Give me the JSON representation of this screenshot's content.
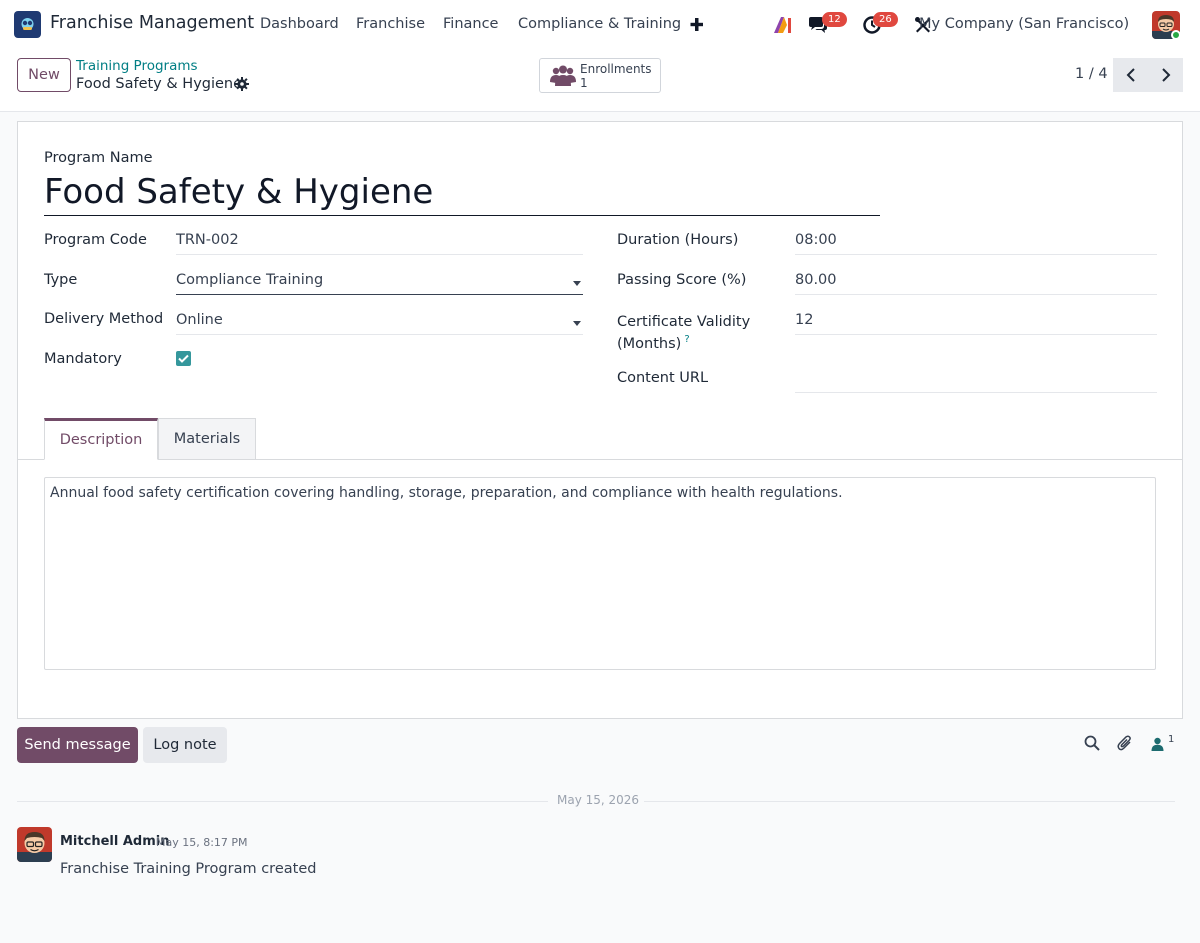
{
  "navbar": {
    "app_title": "Franchise Management",
    "menus": [
      "Dashboard",
      "Franchise",
      "Finance",
      "Compliance & Training"
    ],
    "messages_badge": "12",
    "activities_badge": "26",
    "company": "My Company (San Francisco)"
  },
  "control_panel": {
    "new_label": "New",
    "breadcrumb_parent": "Training Programs",
    "breadcrumb_current": "Food Safety & Hygiene",
    "smart_button": {
      "label": "Enrollments",
      "count": "1"
    },
    "pager": "1 / 4"
  },
  "form": {
    "program_name_label": "Program Name",
    "program_name": "Food Safety & Hygiene",
    "program_code_label": "Program Code",
    "program_code": "TRN-002",
    "type_label": "Type",
    "type": "Compliance Training",
    "delivery_label": "Delivery Method",
    "delivery": "Online",
    "mandatory_label": "Mandatory",
    "mandatory": true,
    "duration_label": "Duration (Hours)",
    "duration": "08:00",
    "passing_label": "Passing Score (%)",
    "passing": "80.00",
    "cert_label_line1": "Certificate Validity",
    "cert_label_line2": "(Months)",
    "cert_tooltip": "?",
    "cert": "12",
    "content_url_label": "Content URL",
    "content_url": ""
  },
  "tabs": {
    "description": "Description",
    "materials": "Materials"
  },
  "description_text": "Annual food safety certification covering handling, storage, preparation, and compliance with health regulations.",
  "chatter": {
    "send_label": "Send message",
    "log_label": "Log note",
    "followers_count": "1",
    "date_separator": "May 15, 2026",
    "message": {
      "author": "Mitchell Admin",
      "time": "May 15, 8:17 PM",
      "body": "Franchise Training Program created"
    }
  },
  "colors": {
    "brand": "#714b67",
    "link": "#017e84",
    "checkbox": "#35979c",
    "badge": "#e0483f"
  }
}
